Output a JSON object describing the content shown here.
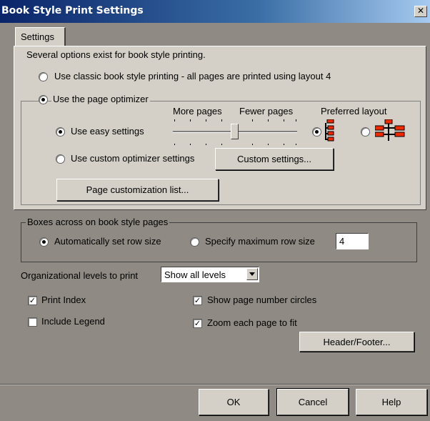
{
  "window": {
    "title": "Book Style Print Settings",
    "close_label": "✕"
  },
  "tabs": [
    {
      "label": "Settings"
    }
  ],
  "settings": {
    "intro": "Several options exist for book style printing.",
    "classic_label": "Use classic book style printing - all pages are printed using layout 4",
    "classic_selected": false,
    "optimizer_label": "Use the page optimizer",
    "optimizer_selected": true,
    "more_pages_label": "More pages",
    "fewer_pages_label": "Fewer pages",
    "preferred_layout_label": "Preferred layout",
    "easy_label": "Use easy settings",
    "easy_selected": true,
    "custom_label": "Use custom optimizer settings",
    "custom_selected": false,
    "custom_button": "Custom settings...",
    "customization_button": "Page customization list...",
    "slider_value_fraction": 0.5,
    "layout_option_1_selected": true,
    "layout_option_2_selected": false,
    "layout_icon_1": "vertical-org-chart-icon",
    "layout_icon_2": "horizontal-org-chart-icon",
    "icon_color": "#f02a00"
  },
  "boxes_across": {
    "legend": "Boxes across on book style pages",
    "auto_label": "Automatically set row size",
    "auto_selected": true,
    "max_label": "Specify maximum row size",
    "max_selected": false,
    "max_value": "4"
  },
  "org_levels": {
    "label": "Organizational levels to print",
    "selected": "Show all levels"
  },
  "options": {
    "print_index": {
      "label": "Print Index",
      "checked": true
    },
    "show_page_circles": {
      "label": "Show page number circles",
      "checked": true
    },
    "include_legend": {
      "label": "Include Legend",
      "checked": false
    },
    "zoom_page": {
      "label": "Zoom each page to fit",
      "checked": true
    }
  },
  "buttons": {
    "header_footer": "Header/Footer...",
    "ok": "OK",
    "cancel": "Cancel",
    "help": "Help"
  }
}
